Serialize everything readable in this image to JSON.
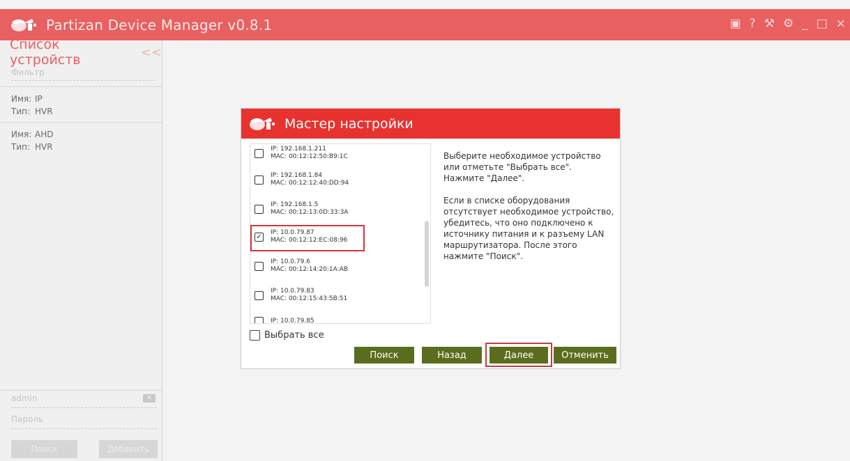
{
  "app": {
    "title": "Partizan Device Manager v0.8.1",
    "accent_color": "#e86060",
    "window_icons": [
      "contacts-icon",
      "help-icon",
      "magic-wand-icon",
      "settings-icon",
      "minimize-icon",
      "maximize-icon",
      "close-icon"
    ]
  },
  "sidebar": {
    "title": "Список устройств",
    "collapse_glyph": "<<",
    "filter_placeholder": "Фильтр",
    "devices": [
      {
        "name_label": "Имя:",
        "name": "IP",
        "type_label": "Тип:",
        "type": "HVR"
      },
      {
        "name_label": "Имя:",
        "name": "AHD",
        "type_label": "Тип:",
        "type": "HVR"
      }
    ],
    "login": {
      "username_value": "admin",
      "password_placeholder": "Пароль",
      "search_button": "Поиск",
      "add_button": "Добавить"
    }
  },
  "dialog": {
    "title": "Мастер настройки",
    "header_color": "#e8322f",
    "devices": [
      {
        "ip": "IP: 192.168.1.211",
        "mac": "MAC: 00:12:12:50:B9:1C",
        "checked": false
      },
      {
        "ip": "IP: 192.168.1.84",
        "mac": "MAC: 00:12:12:40:DD:94",
        "checked": false
      },
      {
        "ip": "IP: 192.168.1.5",
        "mac": "MAC: 00:12:13:0D:33:3A",
        "checked": false
      },
      {
        "ip": "IP: 10.0.79.87",
        "mac": "MAC: 00:12:12:EC:08:96",
        "checked": true
      },
      {
        "ip": "IP: 10.0.79.6",
        "mac": "MAC: 00:12:14:20:1A:AB",
        "checked": false
      },
      {
        "ip": "IP: 10.0.79.83",
        "mac": "MAC: 00:12:15:43:5B:51",
        "checked": false
      },
      {
        "ip": "IP: 10.0.79.85",
        "mac": "",
        "checked": false
      }
    ],
    "help_paragraph_1": "Выберите необходимое устройство или отметьте \"Выбрать все\". Нажмите \"Далее\".",
    "help_paragraph_2": "Если в списке оборудования отсутствует необходимое устройство, убедитесь, что оно подключено к источнику питания и к разъему LAN маршрутизатора. После этого нажмите \"Поиск\".",
    "select_all_label": "Выбрать все",
    "buttons": {
      "search": "Поиск",
      "back": "Назад",
      "next": "Далее",
      "cancel": "Отменить"
    },
    "button_color": "#5a6d1c"
  }
}
